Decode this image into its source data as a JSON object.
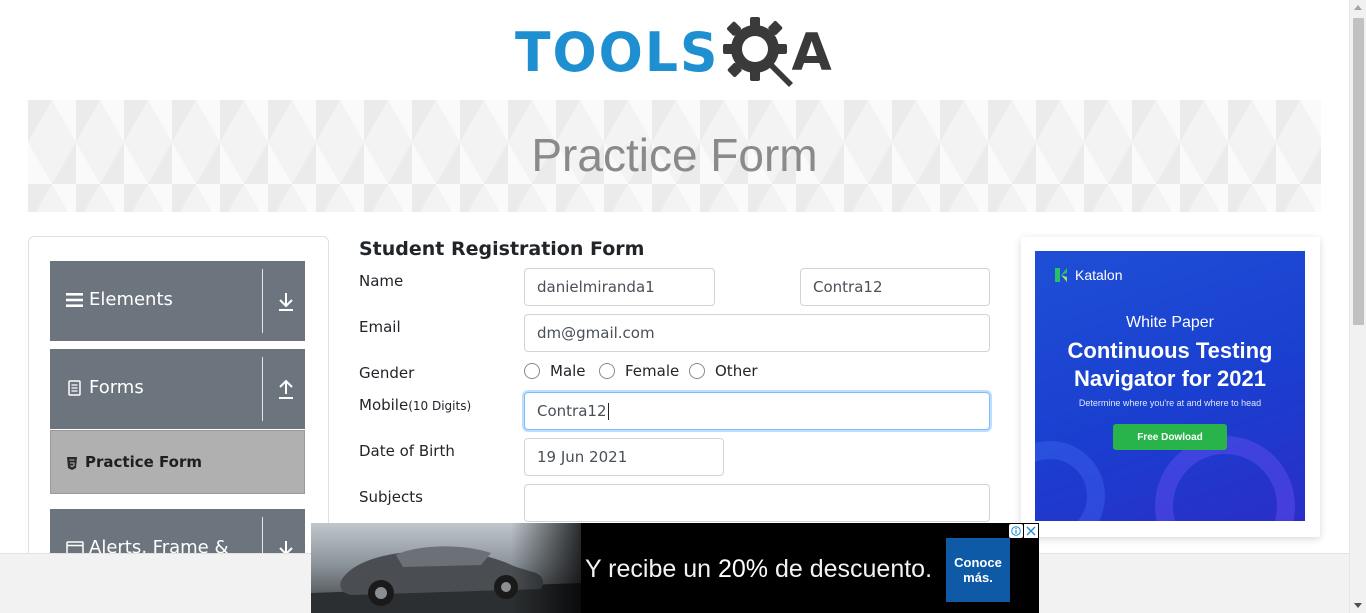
{
  "header": {
    "logo_left": "TOOLS",
    "logo_right": "A"
  },
  "banner": {
    "title": "Practice Form"
  },
  "sidebar": {
    "groups": [
      {
        "label": "Elements",
        "icon": "hamburger-icon",
        "arrow": "download-arrow-icon"
      },
      {
        "label": "Forms",
        "icon": "document-icon",
        "arrow": "upload-arrow-icon"
      },
      {
        "label": "Alerts, Frame &",
        "icon": "window-icon",
        "arrow": "download-arrow-icon"
      }
    ],
    "active_item": {
      "label": "Practice Form",
      "icon": "html5-shield-icon"
    }
  },
  "form": {
    "title": "Student Registration Form",
    "name_label": "Name",
    "first_name": "danielmiranda1",
    "last_name": "Contra12",
    "email_label": "Email",
    "email": "dm@gmail.com",
    "gender_label": "Gender",
    "gender_options": [
      "Male",
      "Female",
      "Other"
    ],
    "mobile_label": "Mobile",
    "mobile_hint": "(10 Digits)",
    "mobile": "Contra12",
    "dob_label": "Date of Birth",
    "dob": "19 Jun 2021",
    "subjects_label": "Subjects",
    "subjects": ""
  },
  "right_ad": {
    "brand": "Katalon",
    "kicker": "White Paper",
    "headline_line1": "Continuous Testing",
    "headline_line2": "Navigator for 2021",
    "sub": "Determine where you're at and where to head",
    "cta": "Free Dowload",
    "accent": "#1f4fd6",
    "cta_color": "#28b44b"
  },
  "bottom_ad": {
    "text_prefix": "Y recibe un",
    "text_highlight": "20%",
    "text_suffix": "de descuento.",
    "cta_line1": "Conoce",
    "cta_line2": "más.",
    "cta_color": "#0e5aa7"
  },
  "colors": {
    "brand_blue": "#1e8fd1",
    "sidebar_group": "#6c757d",
    "active_item": "#b0b0b0"
  }
}
